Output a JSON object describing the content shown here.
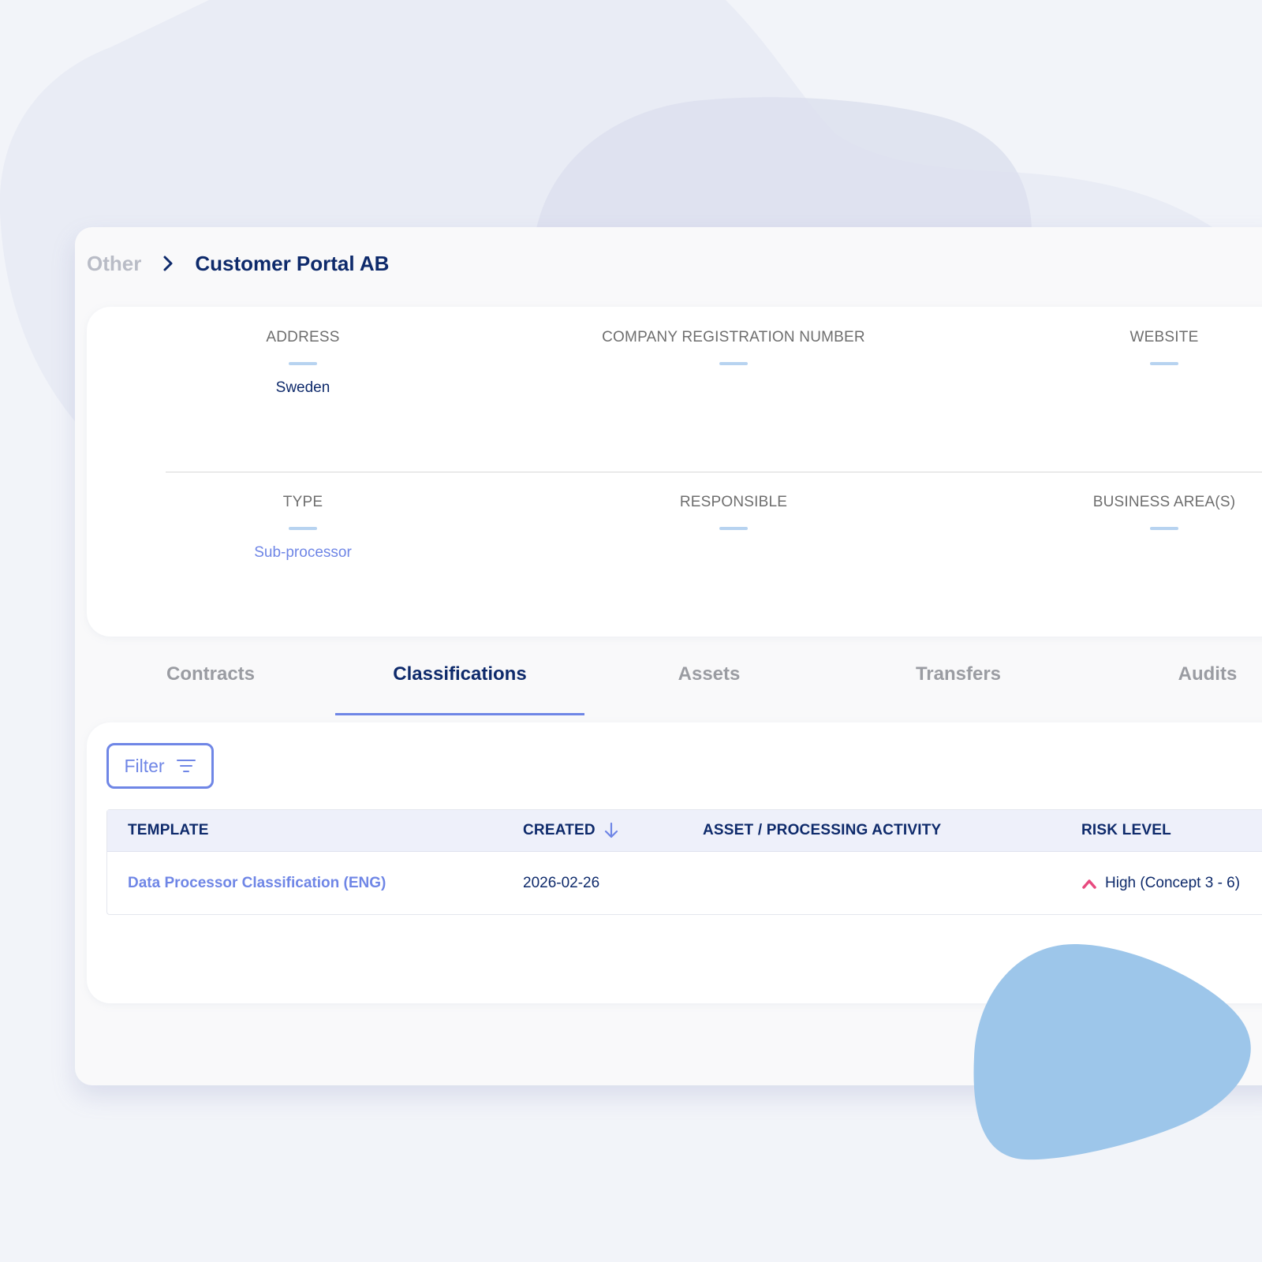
{
  "breadcrumb": {
    "parent": "Other",
    "current": "Customer Portal AB"
  },
  "info": {
    "address": {
      "label": "ADDRESS",
      "value": "Sweden"
    },
    "registration": {
      "label": "COMPANY REGISTRATION NUMBER",
      "value": ""
    },
    "website": {
      "label": "WEBSITE",
      "value": ""
    },
    "type": {
      "label": "TYPE",
      "value": "Sub-processor"
    },
    "responsible": {
      "label": "RESPONSIBLE",
      "value": ""
    },
    "business_areas": {
      "label": "BUSINESS AREA(S)",
      "value": ""
    }
  },
  "tabs": [
    {
      "label": "Contracts",
      "active": false
    },
    {
      "label": "Classifications",
      "active": true
    },
    {
      "label": "Assets",
      "active": false
    },
    {
      "label": "Transfers",
      "active": false
    },
    {
      "label": "Audits",
      "active": false
    }
  ],
  "filter": {
    "label": "Filter",
    "icon": "filter-icon"
  },
  "table": {
    "columns": {
      "template": "TEMPLATE",
      "created": "CREATED",
      "asset": "ASSET / PROCESSING ACTIVITY",
      "risk": "RISK LEVEL"
    },
    "sort": {
      "column": "created",
      "direction": "descending",
      "icon": "arrow-down-icon"
    },
    "rows": [
      {
        "template": "Data Processor Classification (ENG)",
        "created": "2026-02-26",
        "asset": "",
        "risk": "High (Concept 3 - 6)",
        "risk_icon": "chevron-up-icon"
      }
    ]
  },
  "colors": {
    "primary_dark": "#0e2a6b",
    "accent": "#6f86e6",
    "muted": "#9a9ca2",
    "placeholder_dash": "#b7d3f0",
    "risk_high": "#e84a7f",
    "background": "#f2f4f9",
    "decor_blob": "#9dc6ea"
  }
}
